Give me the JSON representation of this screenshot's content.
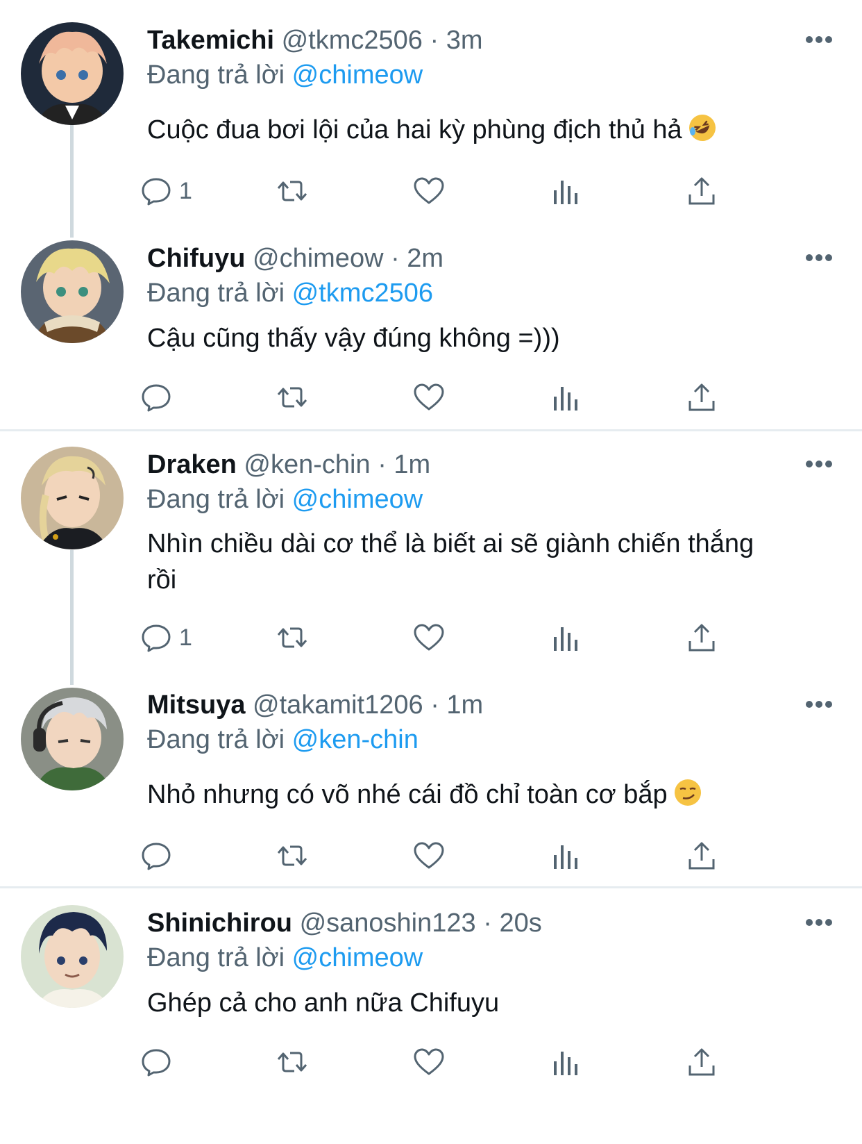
{
  "reply_label": "Đang trả lời",
  "tweets": [
    {
      "name": "Takemichi",
      "handle": "@tkmc2506",
      "sep": "·",
      "time": "3m",
      "reply_to": "@chimeow",
      "text": "Cuộc đua bơi lội của hai kỳ phùng địch thủ hả",
      "emoji": "rofl",
      "reply_count": "1"
    },
    {
      "name": "Chifuyu",
      "handle": "@chimeow",
      "sep": "·",
      "time": "2m",
      "reply_to": "@tkmc2506",
      "text": "Cậu cũng thấy vậy đúng không =)))",
      "reply_count": ""
    },
    {
      "name": "Draken",
      "handle": "@ken-chin",
      "sep": "·",
      "time": "1m",
      "reply_to": "@chimeow",
      "text": "Nhìn chiều dài cơ thể là biết ai sẽ giành chiến thắng rồi",
      "reply_count": "1"
    },
    {
      "name": "Mitsuya",
      "handle": "@takamit1206",
      "sep": "·",
      "time": "1m",
      "reply_to": "@ken-chin",
      "text": "Nhỏ nhưng có võ nhé cái đồ chỉ toàn cơ bắp",
      "emoji": "smirk",
      "reply_count": ""
    },
    {
      "name": "Shinichirou",
      "handle": "@sanoshin123",
      "sep": "·",
      "time": "20s",
      "reply_to": "@chimeow",
      "text": "Ghép cả cho anh nữa Chifuyu",
      "reply_count": ""
    }
  ],
  "colors": {
    "link": "#1d9bf0",
    "secondary": "#536471",
    "thread_line": "#cfd9de",
    "divider": "#e6ecf0"
  },
  "icons": [
    "reply-icon",
    "retweet-icon",
    "like-icon",
    "views-icon",
    "share-icon",
    "more-icon"
  ]
}
